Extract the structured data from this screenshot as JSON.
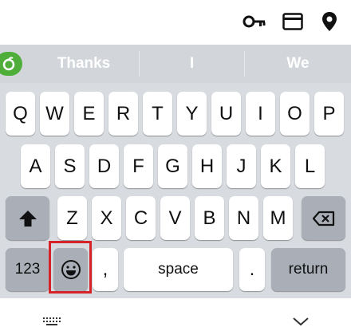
{
  "status_icons": [
    "key-icon",
    "card-icon",
    "location-pin-icon"
  ],
  "suggestions": [
    "Thanks",
    "I",
    "We"
  ],
  "rows": [
    [
      "Q",
      "W",
      "E",
      "R",
      "T",
      "Y",
      "U",
      "I",
      "O",
      "P"
    ],
    [
      "A",
      "S",
      "D",
      "F",
      "G",
      "H",
      "J",
      "K",
      "L"
    ],
    [
      "Z",
      "X",
      "C",
      "V",
      "B",
      "N",
      "M"
    ]
  ],
  "bottom_row": {
    "numbers_label": "123",
    "comma_label": ",",
    "space_label": "space",
    "period_label": ".",
    "return_label": "return"
  },
  "nav_icons": [
    "keyboard-grid-icon",
    "chevron-down-icon"
  ],
  "colors": {
    "highlight": "#d6232a",
    "keyboard_bg": "#d8dbe0",
    "function_key": "#a9aeb7",
    "logo_green": "#4fae3a"
  }
}
